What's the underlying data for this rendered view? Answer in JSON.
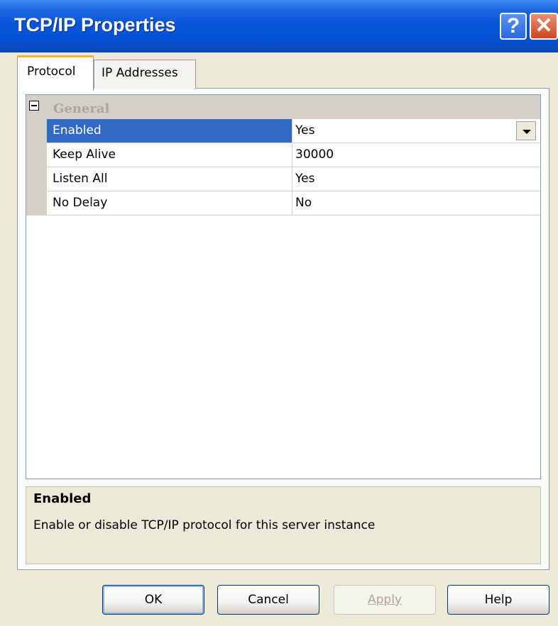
{
  "window": {
    "title": "TCP/IP Properties",
    "help_glyph": "?",
    "close_glyph": "✕"
  },
  "tabs": [
    {
      "label": "Protocol",
      "selected": true
    },
    {
      "label": "IP Addresses",
      "selected": false
    }
  ],
  "grid": {
    "category": "General",
    "properties": [
      {
        "name": "Enabled",
        "value": "Yes",
        "selected": true
      },
      {
        "name": "Keep Alive",
        "value": "30000"
      },
      {
        "name": "Listen All",
        "value": "Yes"
      },
      {
        "name": "No Delay",
        "value": "No"
      }
    ]
  },
  "description": {
    "title": "Enabled",
    "text": "Enable or disable TCP/IP protocol for this server instance"
  },
  "buttons": {
    "ok": "OK",
    "cancel": "Cancel",
    "apply": "Apply",
    "help": "Help"
  },
  "colors": {
    "titlebar": "#0854d8",
    "selection": "#316ac5",
    "tab_accent": "#f9b23b"
  }
}
